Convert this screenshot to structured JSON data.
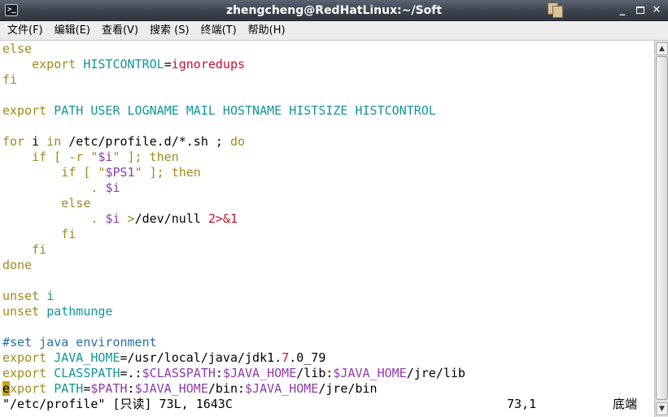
{
  "window": {
    "title": "zhengcheng@RedHatLinux:~/Soft",
    "icon_glyph": ">_",
    "minimize_glyph": "_",
    "close_glyph": "✕"
  },
  "menu": [
    "文件(F)",
    "编辑(E)",
    "查看(V)",
    "搜索 (S)",
    "终端(T)",
    "帮助(H)"
  ],
  "colors": {
    "keyword": "#a08a1c",
    "identifier": "#12959a",
    "string_value": "#c8102e",
    "variable": "#8e3ca8",
    "comment": "#246fa8",
    "cursor": "#c9a212"
  },
  "terminal_lines": [
    [
      [
        "else",
        "kw"
      ]
    ],
    [
      [
        "    "
      ],
      [
        "export",
        "kw"
      ],
      [
        " "
      ],
      [
        "HISTCONTROL",
        "cyan"
      ],
      [
        "="
      ],
      [
        "ignoredups",
        "red"
      ]
    ],
    [
      [
        "fi",
        "kw"
      ]
    ],
    [
      [
        ""
      ]
    ],
    [
      [
        "export",
        "kw"
      ],
      [
        " "
      ],
      [
        "PATH USER LOGNAME MAIL HOSTNAME HISTSIZE HISTCONTROL",
        "cyan"
      ]
    ],
    [
      [
        ""
      ]
    ],
    [
      [
        "for",
        "kw"
      ],
      [
        " i "
      ],
      [
        "in",
        "kw"
      ],
      [
        " /etc/profile.d/*.sh ; "
      ],
      [
        "do",
        "kw"
      ]
    ],
    [
      [
        "    "
      ],
      [
        "if [ -r ",
        "kw"
      ],
      [
        "\"",
        "kw"
      ],
      [
        "$i",
        "purple"
      ],
      [
        "\" ]; then",
        "kw"
      ]
    ],
    [
      [
        "        "
      ],
      [
        "if [ ",
        "kw"
      ],
      [
        "\"",
        "kw"
      ],
      [
        "$PS1",
        "purple"
      ],
      [
        "\" ]; then",
        "kw"
      ]
    ],
    [
      [
        "            "
      ],
      [
        ". ",
        "kw"
      ],
      [
        "$i",
        "purple"
      ]
    ],
    [
      [
        "        "
      ],
      [
        "else",
        "kw"
      ]
    ],
    [
      [
        "            "
      ],
      [
        ". ",
        "kw"
      ],
      [
        "$i",
        "purple"
      ],
      [
        " "
      ],
      [
        ">",
        "kw"
      ],
      [
        "/dev/null "
      ],
      [
        "2>&1",
        "red"
      ]
    ],
    [
      [
        "        "
      ],
      [
        "fi",
        "kw"
      ]
    ],
    [
      [
        "    "
      ],
      [
        "fi",
        "kw"
      ]
    ],
    [
      [
        "done",
        "kw"
      ]
    ],
    [
      [
        ""
      ]
    ],
    [
      [
        "unset",
        "kw"
      ],
      [
        " "
      ],
      [
        "i",
        "cyan"
      ]
    ],
    [
      [
        "unset",
        "kw"
      ],
      [
        " "
      ],
      [
        "pathmunge",
        "cyan"
      ]
    ],
    [
      [
        ""
      ]
    ],
    [
      [
        "#set java environment",
        "cmt"
      ]
    ],
    [
      [
        "export",
        "kw"
      ],
      [
        " "
      ],
      [
        "JAVA_HOME",
        "cyan"
      ],
      [
        "=/usr/local/java/jdk1."
      ],
      [
        "7",
        "red"
      ],
      [
        ".0_79"
      ]
    ],
    [
      [
        "export",
        "kw"
      ],
      [
        " "
      ],
      [
        "CLASSPATH",
        "cyan"
      ],
      [
        "=.:"
      ],
      [
        "$CLASSPATH",
        "purple"
      ],
      [
        ":"
      ],
      [
        "$JAVA_HOME",
        "purple"
      ],
      [
        "/lib:"
      ],
      [
        "$JAVA_HOME",
        "purple"
      ],
      [
        "/jre/lib"
      ]
    ],
    [
      [
        "e",
        "cursor"
      ],
      [
        "xport",
        "kw"
      ],
      [
        " "
      ],
      [
        "PATH",
        "cyan"
      ],
      [
        "="
      ],
      [
        "$PATH",
        "purple"
      ],
      [
        ":"
      ],
      [
        "$JAVA_HOME",
        "purple"
      ],
      [
        "/bin:"
      ],
      [
        "$JAVA_HOME",
        "purple"
      ],
      [
        "/jre/bin"
      ]
    ]
  ],
  "status": {
    "file_info": "\"/etc/profile\" [只读] 73L, 1643C",
    "cursor_position": "73,1",
    "scroll_position": "底端"
  },
  "scrollbar": {
    "up_glyph": "▲",
    "down_glyph": "▼"
  }
}
